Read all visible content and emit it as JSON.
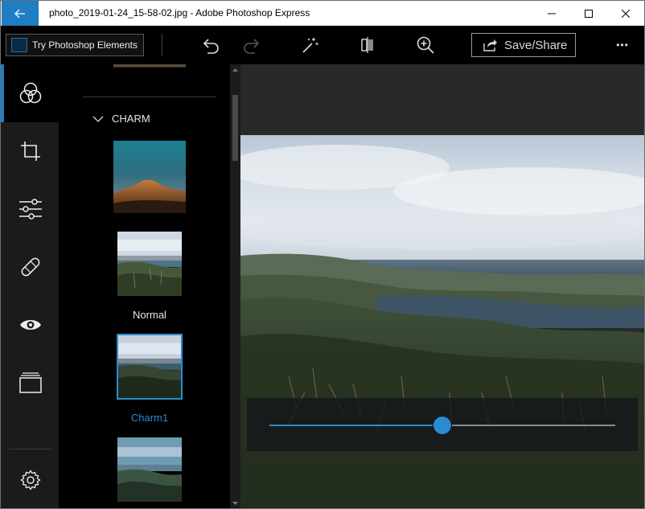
{
  "window": {
    "title": "photo_2019-01-24_15-58-02.jpg - Adobe Photoshop Express"
  },
  "toolbar": {
    "try_label": "Try Photoshop Elements",
    "save_label": "Save/Share",
    "more_label": "•••"
  },
  "rail": {
    "items": [
      "looks-icon",
      "crop-icon",
      "adjustments-icon",
      "healing-icon",
      "red-eye-icon",
      "borders-icon"
    ],
    "active": "looks-icon"
  },
  "panel": {
    "section_title": "CHARM",
    "filters": [
      {
        "label": "Normal",
        "selected": false
      },
      {
        "label": "Charm1",
        "selected": true
      }
    ]
  },
  "slider": {
    "value": 0.5
  },
  "colors": {
    "accent": "#1f7dc4",
    "selected_label": "#2b8bd0"
  }
}
